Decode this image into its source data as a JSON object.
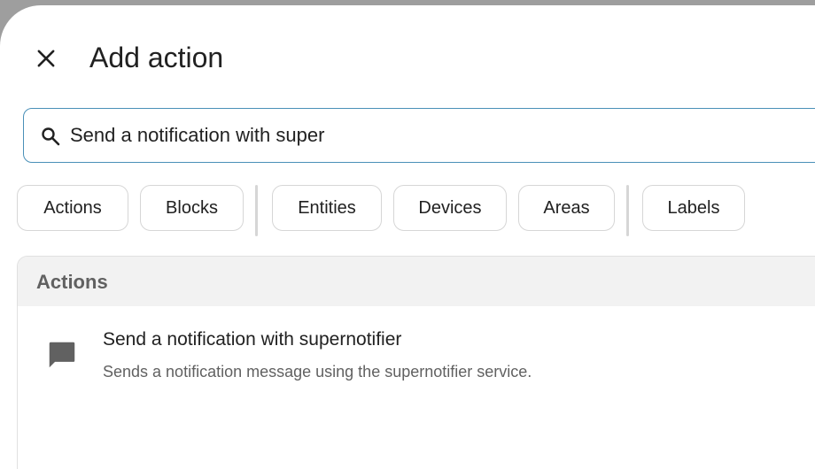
{
  "dialog": {
    "title": "Add action",
    "close_icon": "close-icon"
  },
  "search": {
    "value": "Send a notification with super",
    "icon": "search-icon"
  },
  "filters": {
    "chips": [
      "Actions",
      "Blocks",
      "Entities",
      "Devices",
      "Areas",
      "Labels"
    ]
  },
  "results": {
    "section_label": "Actions",
    "items": [
      {
        "title": "Send a notification with supernotifier",
        "description": "Sends a notification message using the supernotifier service.",
        "icon": "message-icon"
      }
    ]
  },
  "colors": {
    "search_border": "#4a90b8",
    "text_primary": "#212121",
    "text_secondary": "#616161",
    "chip_border": "#d6d6d6",
    "section_header_bg": "#f2f2f2"
  }
}
